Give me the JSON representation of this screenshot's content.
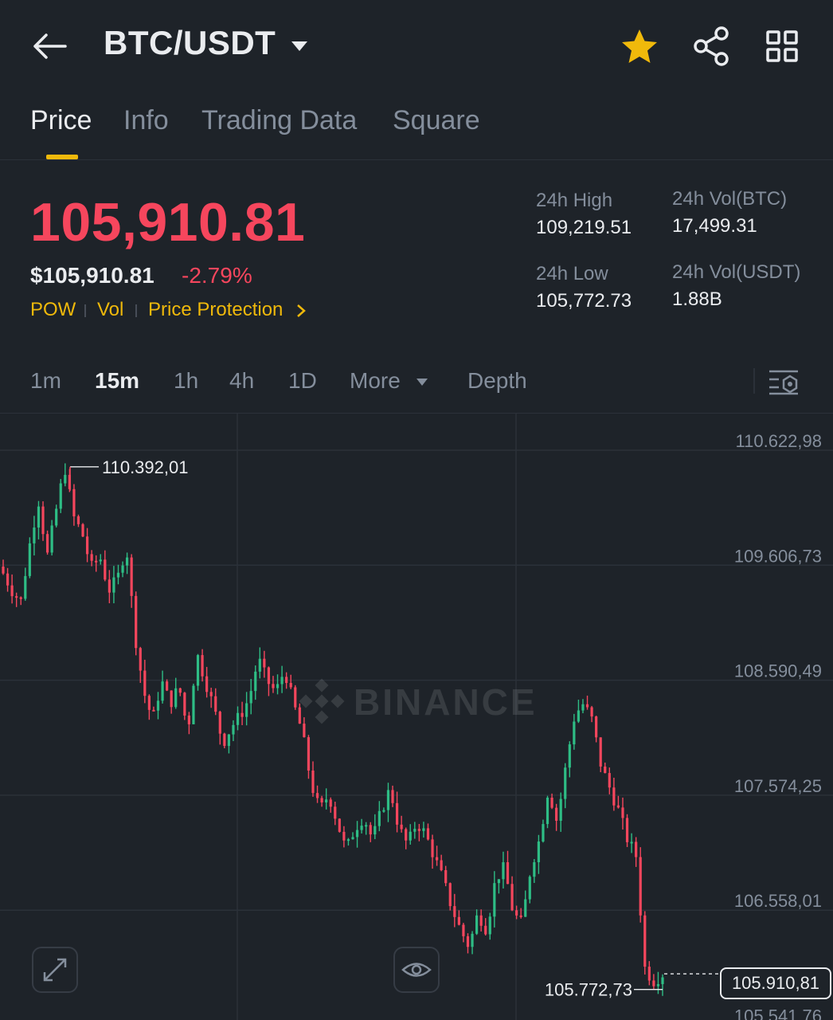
{
  "header": {
    "pair": "BTC/USDT",
    "icons": [
      "back-arrow-icon",
      "caret-down-icon",
      "star-icon",
      "share-icon",
      "grid-icon"
    ],
    "favorite_color": "#f0b90b"
  },
  "tabs": [
    {
      "label": "Price",
      "active": true
    },
    {
      "label": "Info"
    },
    {
      "label": "Trading Data"
    },
    {
      "label": "Square"
    }
  ],
  "price": {
    "last": "105,910.81",
    "usd": "$105,910.81",
    "change": "-2.79%",
    "down_color": "#f6465d",
    "up_color": "#2ebd85"
  },
  "tags": [
    "POW",
    "Vol",
    "Price Protection"
  ],
  "stats": {
    "high_label": "24h High",
    "high": "109,219.51",
    "low_label": "24h Low",
    "low": "105,772.73",
    "vol_btc_label": "24h Vol(BTC)",
    "vol_btc": "17,499.31",
    "vol_usdt_label": "24h Vol(USDT)",
    "vol_usdt": "1.88B"
  },
  "intervals": {
    "items": [
      "1m",
      "15m",
      "1h",
      "4h",
      "1D"
    ],
    "active": "15m",
    "more": "More",
    "depth": "Depth"
  },
  "chart_data": {
    "type": "candlestick",
    "y_ticks": [
      "110.622,98",
      "109.606,73",
      "108.590,49",
      "107.574,25",
      "106.558,01",
      "105.541,76"
    ],
    "ylim": [
      105541.76,
      110622.98
    ],
    "high_marker": "110.392,01",
    "low_marker": "105.772,73",
    "current_marker": "105.910,81",
    "watermark": "BINANCE",
    "close_path": [
      109450,
      109300,
      109200,
      109700,
      110100,
      109600,
      110000,
      110392,
      109950,
      109800,
      109500,
      109600,
      109300,
      109400,
      109700,
      108900,
      108400,
      108150,
      108500,
      108300,
      108450,
      108050,
      108750,
      108500,
      108250,
      107950,
      108100,
      108200,
      108350,
      108700,
      108500,
      108400,
      108600,
      108300,
      108050,
      107600,
      107350,
      107500,
      107250,
      107000,
      107200,
      107300,
      107100,
      107350,
      107550,
      107200,
      107050,
      107250,
      107150,
      106950,
      106750,
      106500,
      106300,
      106150,
      106450,
      106300,
      106750,
      106850,
      106450,
      106350,
      106850,
      107100,
      107550,
      107250,
      107750,
      108200,
      108300,
      108150,
      107750,
      107550,
      107350,
      107100,
      106950,
      105950,
      105850,
      105910
    ],
    "candle_count": 150
  }
}
